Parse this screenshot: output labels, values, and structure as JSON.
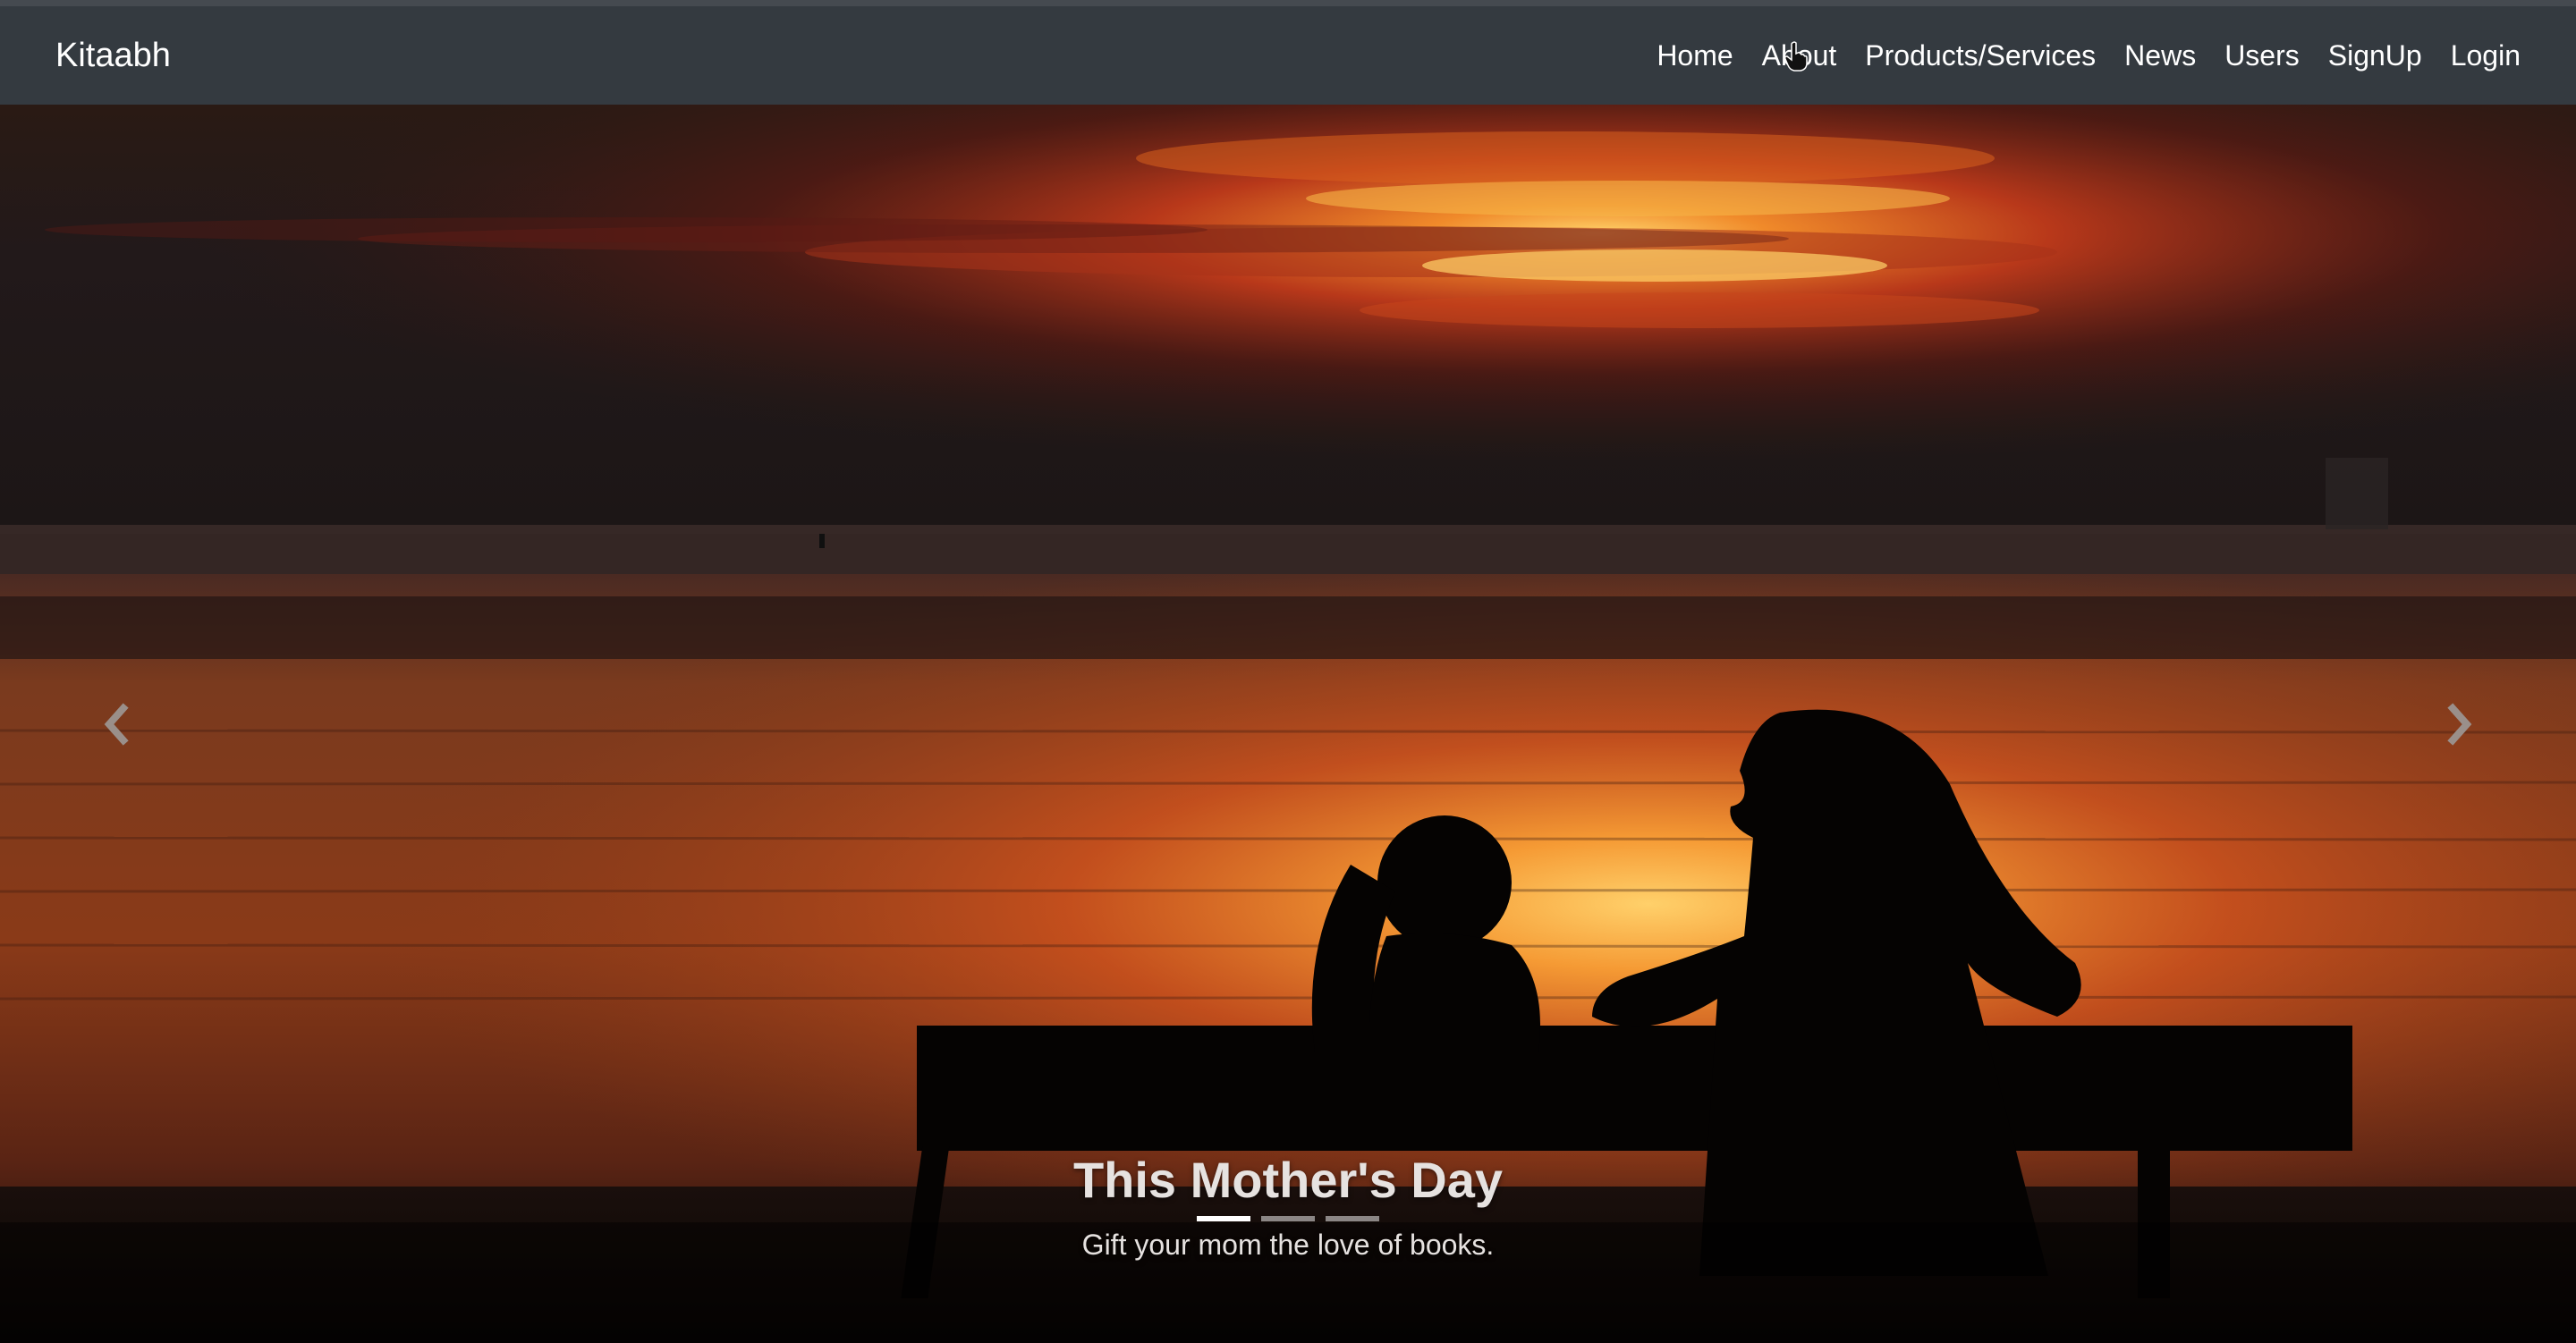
{
  "navbar": {
    "brand": "Kitaabh",
    "links": [
      "Home",
      "About",
      "Products/Services",
      "News",
      "Users",
      "SignUp",
      "Login"
    ]
  },
  "carousel": {
    "caption_title": "This Mother's Day",
    "caption_text": "Gift your mom the love of books.",
    "indicator_count": 3,
    "active_indicator": 1
  },
  "colors": {
    "navbar_bg": "#343a40",
    "sky_dark": "#1f1a18",
    "sunset": "#e0641e",
    "sun_glow": "#f5c04a"
  },
  "icons": [
    "chevron-left-icon",
    "chevron-right-icon",
    "hand-cursor-icon"
  ]
}
